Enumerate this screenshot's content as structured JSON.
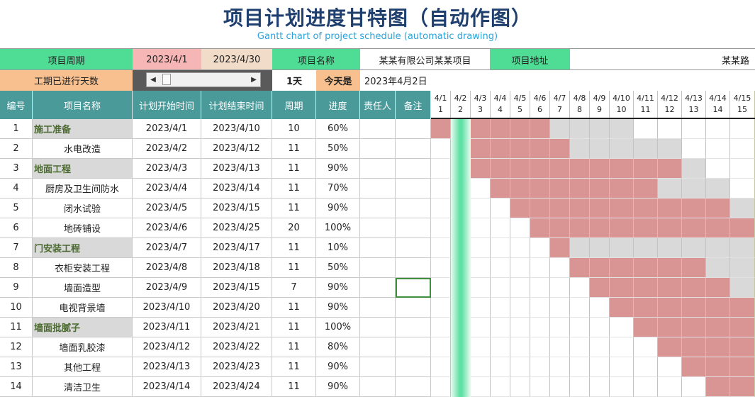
{
  "title": "项目计划进度甘特图（自动作图）",
  "subtitle": "Gantt chart of project schedule (automatic drawing)",
  "info": {
    "cycle_label": "项目周期",
    "start_date": "2023/4/1",
    "end_date": "2023/4/30",
    "name_label": "项目名称",
    "name_value": "某某有限公司某某项目",
    "address_label": "项目地址",
    "address_value": "某某路",
    "elapsed_label": "工期已进行天数",
    "elapsed_value": "1天",
    "today_label": "今天是",
    "today_value": "2023年4月2日"
  },
  "headers": {
    "no": "编号",
    "name": "项目名称",
    "start": "计划开始时间",
    "end": "计划结束时间",
    "period": "周期",
    "progress": "进度",
    "owner": "责任人",
    "note": "备注"
  },
  "days": [
    "4/1",
    "4/2",
    "4/3",
    "4/4",
    "4/5",
    "4/6",
    "4/7",
    "4/8",
    "4/9",
    "4/10",
    "4/11",
    "4/12",
    "4/13",
    "4/14",
    "4/15"
  ],
  "day_nums": [
    "1",
    "2",
    "3",
    "4",
    "5",
    "6",
    "7",
    "8",
    "9",
    "10",
    "11",
    "12",
    "13",
    "14",
    "15"
  ],
  "today_index": 1,
  "colors": {
    "done": "#d99594",
    "remaining": "#d9d9d9",
    "today": "#5fe0a4",
    "header": "#4a9a9a"
  },
  "rows": [
    {
      "no": "1",
      "name": "施工准备",
      "start": "2023/4/1",
      "end": "2023/4/10",
      "period": "10",
      "progress": "60%",
      "cat": true,
      "s": 1,
      "p": 0.6
    },
    {
      "no": "2",
      "name": "水电改造",
      "start": "2023/4/2",
      "end": "2023/4/12",
      "period": "11",
      "progress": "50%",
      "cat": false,
      "s": 2,
      "p": 0.5
    },
    {
      "no": "3",
      "name": "地面工程",
      "start": "2023/4/3",
      "end": "2023/4/13",
      "period": "11",
      "progress": "90%",
      "cat": true,
      "s": 3,
      "p": 0.9
    },
    {
      "no": "4",
      "name": "厨房及卫生间防水",
      "start": "2023/4/4",
      "end": "2023/4/14",
      "period": "11",
      "progress": "70%",
      "cat": false,
      "s": 4,
      "p": 0.7
    },
    {
      "no": "5",
      "name": "闭水试验",
      "start": "2023/4/5",
      "end": "2023/4/15",
      "period": "11",
      "progress": "90%",
      "cat": false,
      "s": 5,
      "p": 0.9
    },
    {
      "no": "6",
      "name": "地砖铺设",
      "start": "2023/4/6",
      "end": "2023/4/25",
      "period": "20",
      "progress": "100%",
      "cat": false,
      "s": 6,
      "p": 1.0
    },
    {
      "no": "7",
      "name": "门安装工程",
      "start": "2023/4/7",
      "end": "2023/4/17",
      "period": "11",
      "progress": "10%",
      "cat": true,
      "s": 7,
      "p": 0.1
    },
    {
      "no": "8",
      "name": "衣柜安装工程",
      "start": "2023/4/8",
      "end": "2023/4/18",
      "period": "11",
      "progress": "50%",
      "cat": false,
      "s": 8,
      "p": 0.5
    },
    {
      "no": "9",
      "name": "墙面造型",
      "start": "2023/4/9",
      "end": "2023/4/15",
      "period": "7",
      "progress": "90%",
      "cat": false,
      "s": 9,
      "p": 0.9
    },
    {
      "no": "10",
      "name": "电视背景墙",
      "start": "2023/4/10",
      "end": "2023/4/20",
      "period": "11",
      "progress": "90%",
      "cat": false,
      "s": 10,
      "p": 0.9
    },
    {
      "no": "11",
      "name": "墙面批腻子",
      "start": "2023/4/11",
      "end": "2023/4/21",
      "period": "11",
      "progress": "100%",
      "cat": true,
      "s": 11,
      "p": 1.0
    },
    {
      "no": "12",
      "name": "墙面乳胶漆",
      "start": "2023/4/12",
      "end": "2023/4/22",
      "period": "11",
      "progress": "80%",
      "cat": false,
      "s": 12,
      "p": 0.8
    },
    {
      "no": "13",
      "name": "其他工程",
      "start": "2023/4/13",
      "end": "2023/4/23",
      "period": "11",
      "progress": "90%",
      "cat": false,
      "s": 13,
      "p": 0.9
    },
    {
      "no": "14",
      "name": "清洁卫生",
      "start": "2023/4/14",
      "end": "2023/4/24",
      "period": "11",
      "progress": "90%",
      "cat": false,
      "s": 14,
      "p": 0.9
    }
  ]
}
